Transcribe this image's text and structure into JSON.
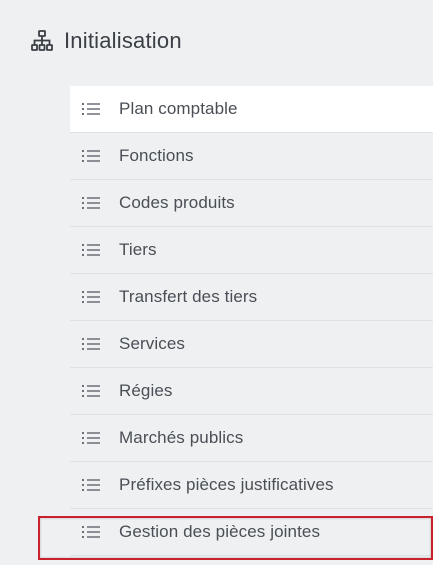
{
  "section": {
    "title": "Initialisation",
    "icon": "sitemap-icon"
  },
  "menu": {
    "item_icon": "list-icon",
    "items": [
      {
        "label": "Plan comptable",
        "active": true
      },
      {
        "label": "Fonctions"
      },
      {
        "label": "Codes produits"
      },
      {
        "label": "Tiers"
      },
      {
        "label": "Transfert des tiers"
      },
      {
        "label": "Services"
      },
      {
        "label": "Régies"
      },
      {
        "label": "Marchés publics"
      },
      {
        "label": "Préfixes pièces justificatives"
      },
      {
        "label": "Gestion des pièces jointes",
        "highlighted": true
      }
    ]
  },
  "colors": {
    "background": "#eef0f2",
    "active_background": "#ffffff",
    "highlight_border": "#c8232c",
    "text": "#3a3f45"
  }
}
